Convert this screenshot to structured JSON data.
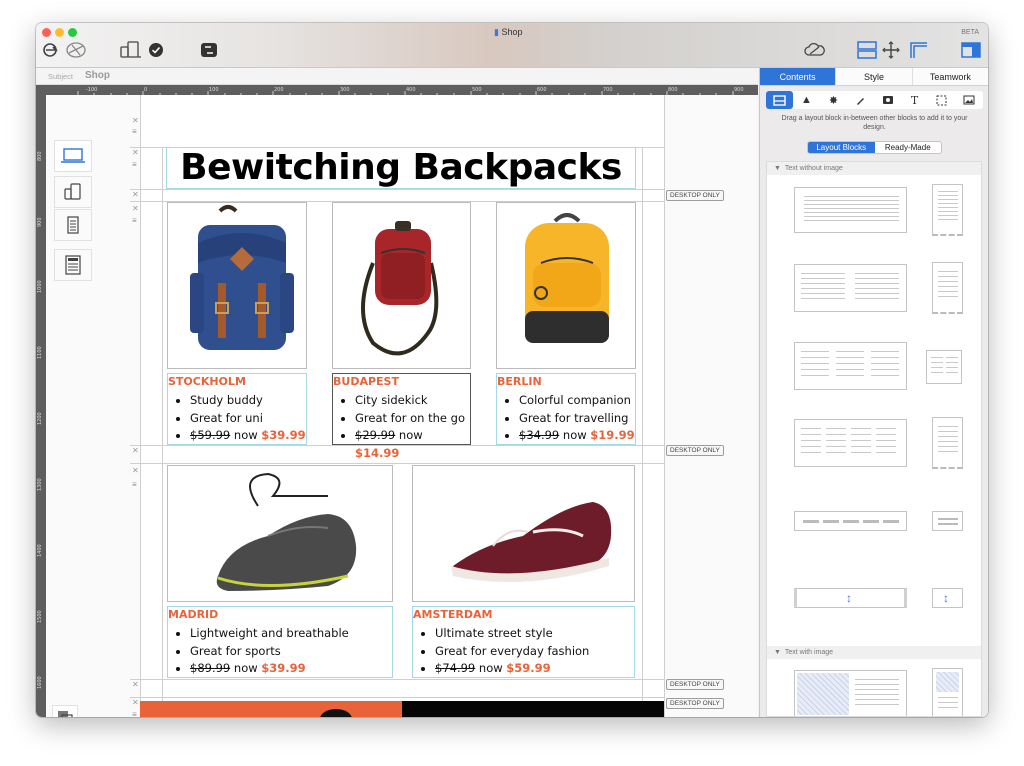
{
  "window": {
    "title": "Shop",
    "beta_label": "BETA",
    "traffic_lights": {
      "close": "#ff5f57",
      "minimize": "#febc2e",
      "zoom": "#28c840"
    }
  },
  "toolbar": {
    "left_icons": [
      "preview-icon",
      "publish-icon",
      "devices-icon",
      "check-icon",
      "toggle-icon"
    ],
    "right_icons": [
      "cloud-icon",
      "layout-blocks-icon",
      "move-icon",
      "guides-icon",
      "sidebar-icon"
    ]
  },
  "subject_bar": {
    "label": "Subject",
    "value": "Shop"
  },
  "ruler": {
    "horizontal": [
      "-100",
      "0",
      "100",
      "200",
      "300",
      "400",
      "500",
      "600",
      "700",
      "800",
      "900"
    ],
    "vertical": [
      "800",
      "900",
      "1000",
      "1100",
      "1200",
      "1300",
      "1400",
      "1500",
      "1600"
    ]
  },
  "devices": [
    "laptop-icon",
    "phone-tablet-icon",
    "document-icon",
    "newsletter-icon"
  ],
  "page": {
    "heading": "Bewitching Backpacks",
    "desktop_only_label": "DESKTOP ONLY",
    "row1": [
      {
        "city": "STOCKHOLM",
        "bullets": [
          "Study buddy",
          "Great for uni"
        ],
        "old_price": "$59.99",
        "now": "now",
        "new_price": "$39.99",
        "image": "blue-backpack"
      },
      {
        "city": "BUDAPEST",
        "bullets": [
          "City sidekick",
          "Great for on the go"
        ],
        "old_price": "$29.99",
        "now": "now",
        "new_price": "$14.99",
        "image": "red-crossbody-bag"
      },
      {
        "city": "BERLIN",
        "bullets": [
          "Colorful companion",
          "Great for travelling"
        ],
        "old_price": "$34.99",
        "now": "now",
        "new_price": "$19.99",
        "image": "yellow-backpack"
      }
    ],
    "row2": [
      {
        "city": "MADRID",
        "bullets": [
          "Lightweight and breathable",
          "Great for sports"
        ],
        "old_price": "$89.99",
        "now": "now",
        "new_price": "$39.99",
        "image": "black-sneaker"
      },
      {
        "city": "AMSTERDAM",
        "bullets": [
          "Ultimate street style",
          "Great for everyday fashion"
        ],
        "old_price": "$74.99",
        "now": "now",
        "new_price": "$59.99",
        "image": "burgundy-sneaker"
      }
    ],
    "accent_color": "#e8633a"
  },
  "panel": {
    "tabs": [
      "Contents",
      "Style",
      "Teamwork"
    ],
    "active_tab": "Contents",
    "tool_icons": [
      "layout-block-icon",
      "triangle-icon",
      "badge-icon",
      "pen-icon",
      "media-icon",
      "text-icon",
      "selection-icon",
      "image-icon"
    ],
    "hint": "Drag a layout block in-between other blocks to add it to your design.",
    "segments": [
      "Layout Blocks",
      "Ready-Made"
    ],
    "active_segment": "Layout Blocks",
    "sections": [
      "Text without image",
      "Text with image"
    ],
    "accent_color": "#2f74d8"
  }
}
